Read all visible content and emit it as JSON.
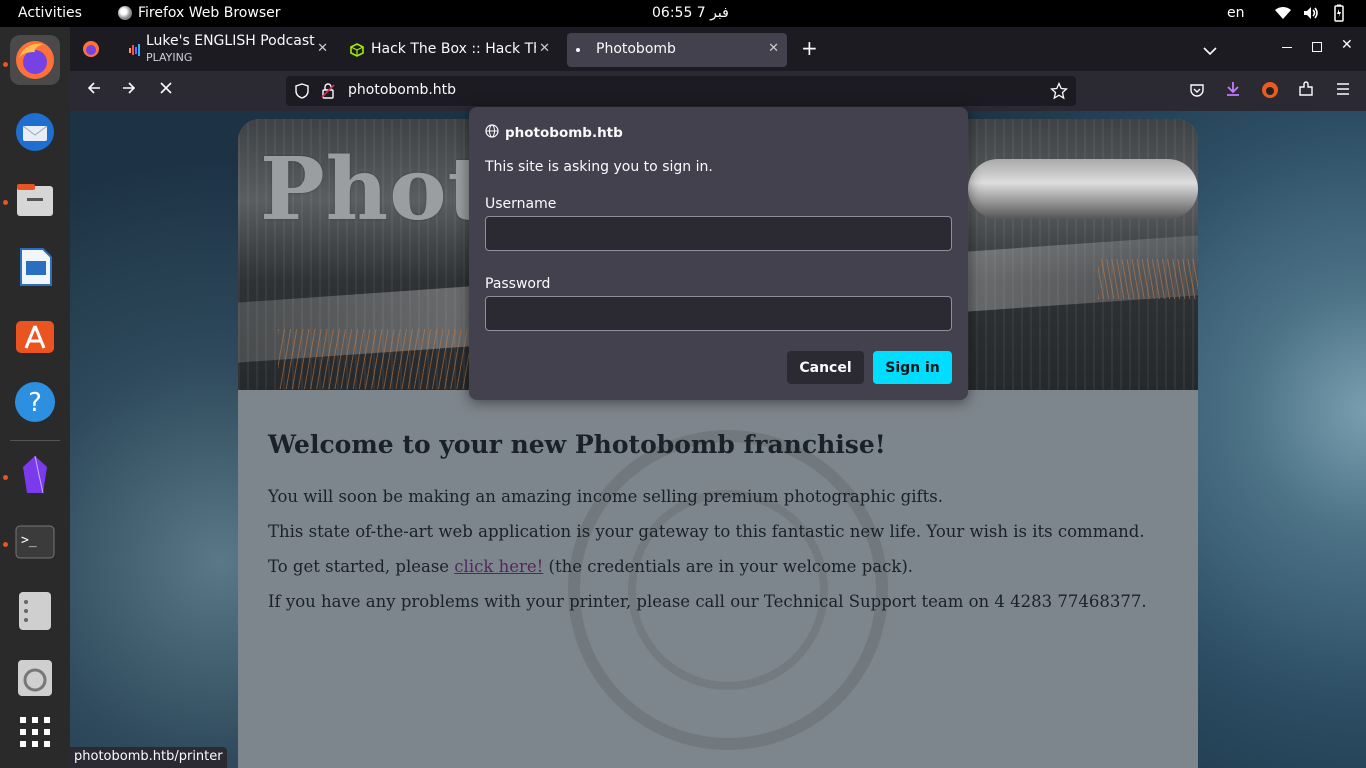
{
  "topbar": {
    "activities": "Activities",
    "app_name": "Firefox Web Browser",
    "clock": "06:55  فبر 7",
    "lang": "en"
  },
  "dock": {
    "items": [
      "firefox-icon",
      "thunderbird-icon",
      "files-icon",
      "writer-icon",
      "app-center-icon",
      "help-icon",
      "obsidian-icon",
      "terminal-icon",
      "file-manager-icon",
      "disk-icon",
      "show-apps-icon"
    ]
  },
  "tabs": [
    {
      "title": "Luke's ENGLISH Podcast",
      "subtitle": "PLAYING"
    },
    {
      "title": "Hack The Box :: Hack The"
    },
    {
      "title": "Photobomb"
    }
  ],
  "navbar": {
    "url": "photobomb.htb"
  },
  "page": {
    "banner_text": "Phot",
    "heading": "Welcome to your new Photobomb franchise!",
    "p1": "You will soon be making an amazing income selling premium photographic gifts.",
    "p2": "This state of-the-art web application is your gateway to this fantastic new life. Your wish is its command.",
    "p3_before": "To get started, please ",
    "p3_link": "click here!",
    "p3_after": " (the credentials are in your welcome pack).",
    "p4": "If you have any problems with your printer, please call our Technical Support team on 4 4283 77468377."
  },
  "statuslink": "photobomb.htb/printer",
  "dialog": {
    "host": "photobomb.htb",
    "message": "This site is asking you to sign in.",
    "username_label": "Username",
    "username_value": "",
    "password_label": "Password",
    "password_value": "",
    "cancel": "Cancel",
    "signin": "Sign in"
  },
  "colors": {
    "signin_accent": "#00ddff",
    "dialog_bg": "#42414d",
    "tabbar_bg": "#1c1b22"
  }
}
